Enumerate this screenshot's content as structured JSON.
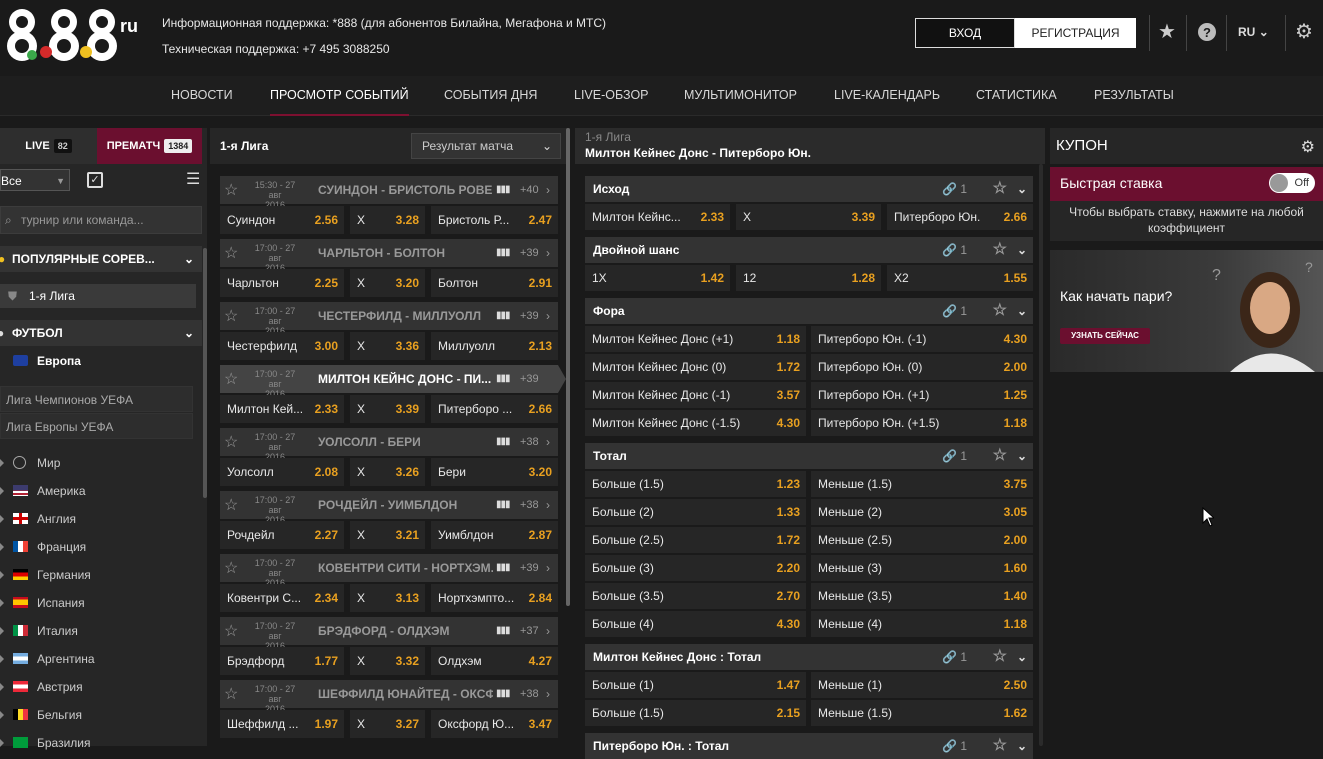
{
  "header": {
    "logo_text": "888",
    "logo_ru": "ru",
    "support_info": "Информационная поддержка: *888 (для абонентов Билайна, Мегафона и МТС)",
    "support_tech": "Техническая поддержка: +7 495 3088250",
    "login_label": "ВХОД",
    "register_label": "РЕГИСТРАЦИЯ",
    "lang": "RU"
  },
  "nav": {
    "items": [
      "НОВОСТИ",
      "ПРОСМОТР СОБЫТИЙ",
      "СОБЫТИЯ ДНЯ",
      "LIVE-ОБЗОР",
      "МУЛЬТИМОНИТОР",
      "LIVE-КАЛЕНДАРЬ",
      "СТАТИСТИКА",
      "РЕЗУЛЬТАТЫ"
    ]
  },
  "sidebar": {
    "live_label": "LIVE",
    "live_count": "82",
    "prematch_label": "ПРЕМАТЧ",
    "prematch_count": "1384",
    "filter_value": "Все",
    "search_placeholder": "турнир или команда...",
    "popular_label": "ПОПУЛЯРНЫЕ СОРЕВ...",
    "popular_item": "1-я Лига",
    "football_label": "ФУТБОЛ",
    "europe_label": "Европа",
    "leagues": [
      "Лига Чемпионов УЕФА",
      "Лига Европы УЕФА"
    ],
    "countries": [
      "Мир",
      "Америка",
      "Англия",
      "Франция",
      "Германия",
      "Испания",
      "Италия",
      "Аргентина",
      "Австрия",
      "Бельгия",
      "Бразилия"
    ]
  },
  "events": {
    "league": "1-я Лига",
    "market_select": "Результат матча",
    "list": [
      {
        "time": "15:30 - 27 авг",
        "year": "2016",
        "name": "СУИНДОН - БРИСТОЛЬ РОВЕ...",
        "more": "+40",
        "h": "Суиндон",
        "hv": "2.56",
        "x": "X",
        "xv": "3.28",
        "a": "Бристоль Р...",
        "av": "2.47"
      },
      {
        "time": "17:00 - 27 авг",
        "year": "2016",
        "name": "ЧАРЛЬТОН - БОЛТОН",
        "more": "+39",
        "h": "Чарльтон",
        "hv": "2.25",
        "x": "X",
        "xv": "3.20",
        "a": "Болтон",
        "av": "2.91"
      },
      {
        "time": "17:00 - 27 авг",
        "year": "2016",
        "name": "ЧЕСТЕРФИЛД - МИЛЛУОЛЛ",
        "more": "+39",
        "h": "Честерфилд",
        "hv": "3.00",
        "x": "X",
        "xv": "3.36",
        "a": "Миллуолл",
        "av": "2.13"
      },
      {
        "time": "17:00 - 27 авг",
        "year": "2016",
        "name": "МИЛТОН КЕЙНС ДОНС - ПИ...",
        "more": "+39",
        "h": "Милтон Кей...",
        "hv": "2.33",
        "x": "X",
        "xv": "3.39",
        "a": "Питерборо ...",
        "av": "2.66"
      },
      {
        "time": "17:00 - 27 авг",
        "year": "2016",
        "name": "УОЛСОЛЛ - БЕРИ",
        "more": "+38",
        "h": "Уолсолл",
        "hv": "2.08",
        "x": "X",
        "xv": "3.26",
        "a": "Бери",
        "av": "3.20"
      },
      {
        "time": "17:00 - 27 авг",
        "year": "2016",
        "name": "РОЧДЕЙЛ - УИМБЛДОН",
        "more": "+38",
        "h": "Рочдейл",
        "hv": "2.27",
        "x": "X",
        "xv": "3.21",
        "a": "Уимблдон",
        "av": "2.87"
      },
      {
        "time": "17:00 - 27 авг",
        "year": "2016",
        "name": "КОВЕНТРИ СИТИ - НОРТХЭМ...",
        "more": "+39",
        "h": "Ковентри С...",
        "hv": "2.34",
        "x": "X",
        "xv": "3.13",
        "a": "Нортхэмпто...",
        "av": "2.84"
      },
      {
        "time": "17:00 - 27 авг",
        "year": "2016",
        "name": "БРЭДФОРД - ОЛДХЭМ",
        "more": "+37",
        "h": "Брэдфорд",
        "hv": "1.77",
        "x": "X",
        "xv": "3.32",
        "a": "Олдхэм",
        "av": "4.27"
      },
      {
        "time": "17:00 - 27 авг",
        "year": "2016",
        "name": "ШЕФФИЛД ЮНАЙТЕД - ОКСФ...",
        "more": "+38",
        "h": "Шеффилд ...",
        "hv": "1.97",
        "x": "X",
        "xv": "3.27",
        "a": "Оксфорд Ю...",
        "av": "3.47"
      }
    ]
  },
  "detail": {
    "league": "1-я Лига",
    "match": "Милтон Кейнес Донс - Питерборо Юн.",
    "markets": [
      {
        "title": "Исход",
        "links": "1",
        "rows": [
          [
            "Милтон Кейнс...",
            "2.33",
            "X",
            "3.39",
            "Питерборо Юн.",
            "2.66"
          ]
        ]
      },
      {
        "title": "Двойной шанс",
        "links": "1",
        "rows": [
          [
            "1X",
            "1.42",
            "12",
            "1.28",
            "X2",
            "1.55"
          ]
        ]
      },
      {
        "title": "Фора",
        "links": "1",
        "rows": [
          [
            "Милтон Кейнес Донс (+1)",
            "1.18",
            "Питерборо Юн. (-1)",
            "4.30"
          ],
          [
            "Милтон Кейнес Донс (0)",
            "1.72",
            "Питерборо Юн. (0)",
            "2.00"
          ],
          [
            "Милтон Кейнес Донс (-1)",
            "3.57",
            "Питерборо Юн. (+1)",
            "1.25"
          ],
          [
            "Милтон Кейнес Донс (-1.5)",
            "4.30",
            "Питерборо Юн. (+1.5)",
            "1.18"
          ]
        ]
      },
      {
        "title": "Тотал",
        "links": "1",
        "rows": [
          [
            "Больше (1.5)",
            "1.23",
            "Меньше (1.5)",
            "3.75"
          ],
          [
            "Больше (2)",
            "1.33",
            "Меньше (2)",
            "3.05"
          ],
          [
            "Больше (2.5)",
            "1.72",
            "Меньше (2.5)",
            "2.00"
          ],
          [
            "Больше (3)",
            "2.20",
            "Меньше (3)",
            "1.60"
          ],
          [
            "Больше (3.5)",
            "2.70",
            "Меньше (3.5)",
            "1.40"
          ],
          [
            "Больше (4)",
            "4.30",
            "Меньше (4)",
            "1.18"
          ]
        ]
      },
      {
        "title": "Милтон Кейнес Донс : Тотал",
        "links": "1",
        "rows": [
          [
            "Больше (1)",
            "1.47",
            "Меньше (1)",
            "2.50"
          ],
          [
            "Больше (1.5)",
            "2.15",
            "Меньше (1.5)",
            "1.62"
          ]
        ]
      },
      {
        "title": "Питерборо Юн. : Тотал",
        "links": "1",
        "rows": []
      }
    ]
  },
  "coupon": {
    "title": "КУПОН",
    "quick_bet": "Быстрая ставка",
    "toggle": "Off",
    "hint": "Чтобы выбрать ставку, нажмите на любой коэффициент",
    "banner_q": "Как начать пари?",
    "banner_btn": "УЗНАТЬ СЕЙЧАС"
  },
  "colors": {
    "accent": "#6b0f2f",
    "odds": "#e8a020"
  }
}
